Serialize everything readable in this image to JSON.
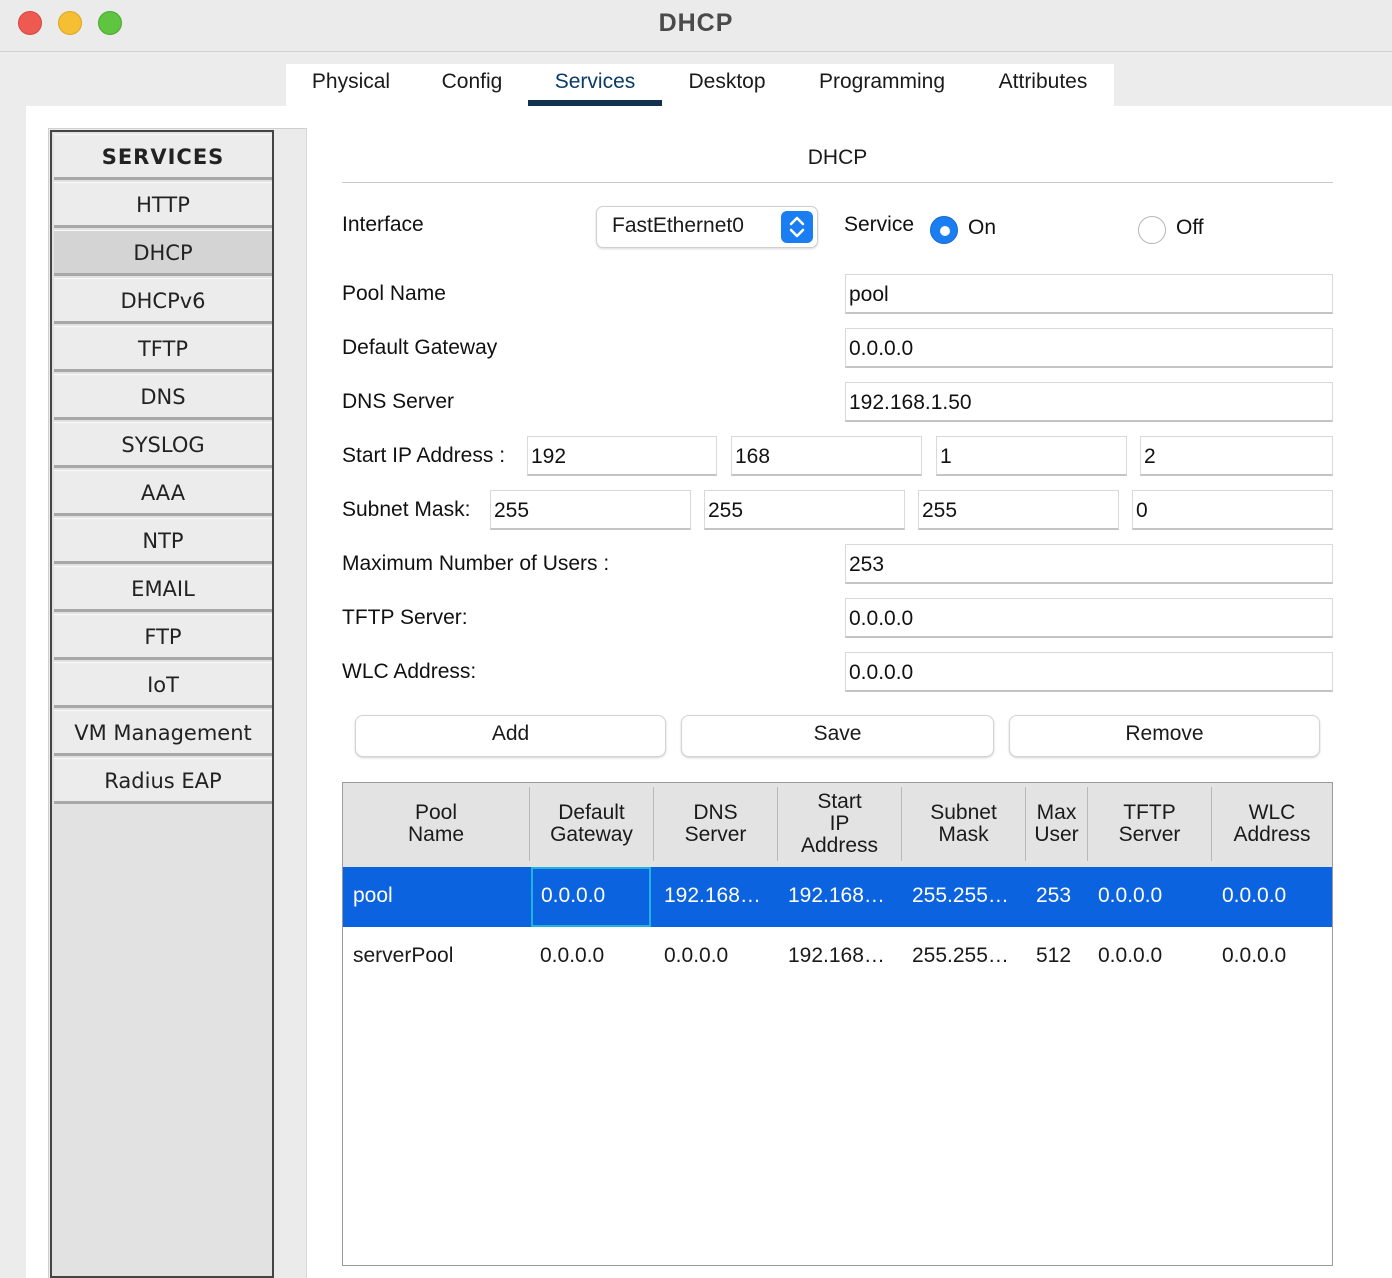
{
  "window": {
    "title": "DHCP"
  },
  "tabs": [
    "Physical",
    "Config",
    "Services",
    "Desktop",
    "Programming",
    "Attributes"
  ],
  "sidebar": {
    "header": "SERVICES",
    "items": [
      "HTTP",
      "DHCP",
      "DHCPv6",
      "TFTP",
      "DNS",
      "SYSLOG",
      "AAA",
      "NTP",
      "EMAIL",
      "FTP",
      "IoT",
      "VM Management",
      "Radius EAP"
    ],
    "selected": "DHCP"
  },
  "dhcp": {
    "section_title": "DHCP",
    "interface_label": "Interface",
    "interface_value": "FastEthernet0",
    "service_label": "Service",
    "on_label": "On",
    "off_label": "Off",
    "service_state": "On",
    "pool_name_label": "Pool Name",
    "pool_name": "pool",
    "default_gateway_label": "Default Gateway",
    "default_gateway": "0.0.0.0",
    "dns_server_label": "DNS Server",
    "dns_server": "192.168.1.50",
    "start_ip_label": "Start IP Address :",
    "start_ip": [
      "192",
      "168",
      "1",
      "2"
    ],
    "subnet_mask_label": "Subnet Mask:",
    "subnet_mask": [
      "255",
      "255",
      "255",
      "0"
    ],
    "max_users_label": "Maximum Number of Users :",
    "max_users": "253",
    "tftp_server_label": "TFTP Server:",
    "tftp_server": "0.0.0.0",
    "wlc_address_label": "WLC Address:",
    "wlc_address": "0.0.0.0",
    "buttons": {
      "add": "Add",
      "save": "Save",
      "remove": "Remove"
    }
  },
  "table": {
    "columns": [
      [
        "Pool",
        "Name"
      ],
      [
        "Default",
        "Gateway"
      ],
      [
        "DNS",
        "Server"
      ],
      [
        "Start",
        "IP",
        "Address"
      ],
      [
        "Subnet",
        "Mask"
      ],
      [
        "Max",
        "User"
      ],
      [
        "TFTP",
        "Server"
      ],
      [
        "WLC",
        "Address"
      ]
    ],
    "rows": [
      [
        "pool",
        "0.0.0.0",
        "192.168…",
        "192.168…",
        "255.255…",
        "253",
        "0.0.0.0",
        "0.0.0.0"
      ],
      [
        "serverPool",
        "0.0.0.0",
        "0.0.0.0",
        "192.168…",
        "255.255…",
        "512",
        "0.0.0.0",
        "0.0.0.0"
      ]
    ],
    "selected_row": 0,
    "colors": {
      "selection": "#0c63e0",
      "focus_border": "#21b3dd"
    }
  }
}
